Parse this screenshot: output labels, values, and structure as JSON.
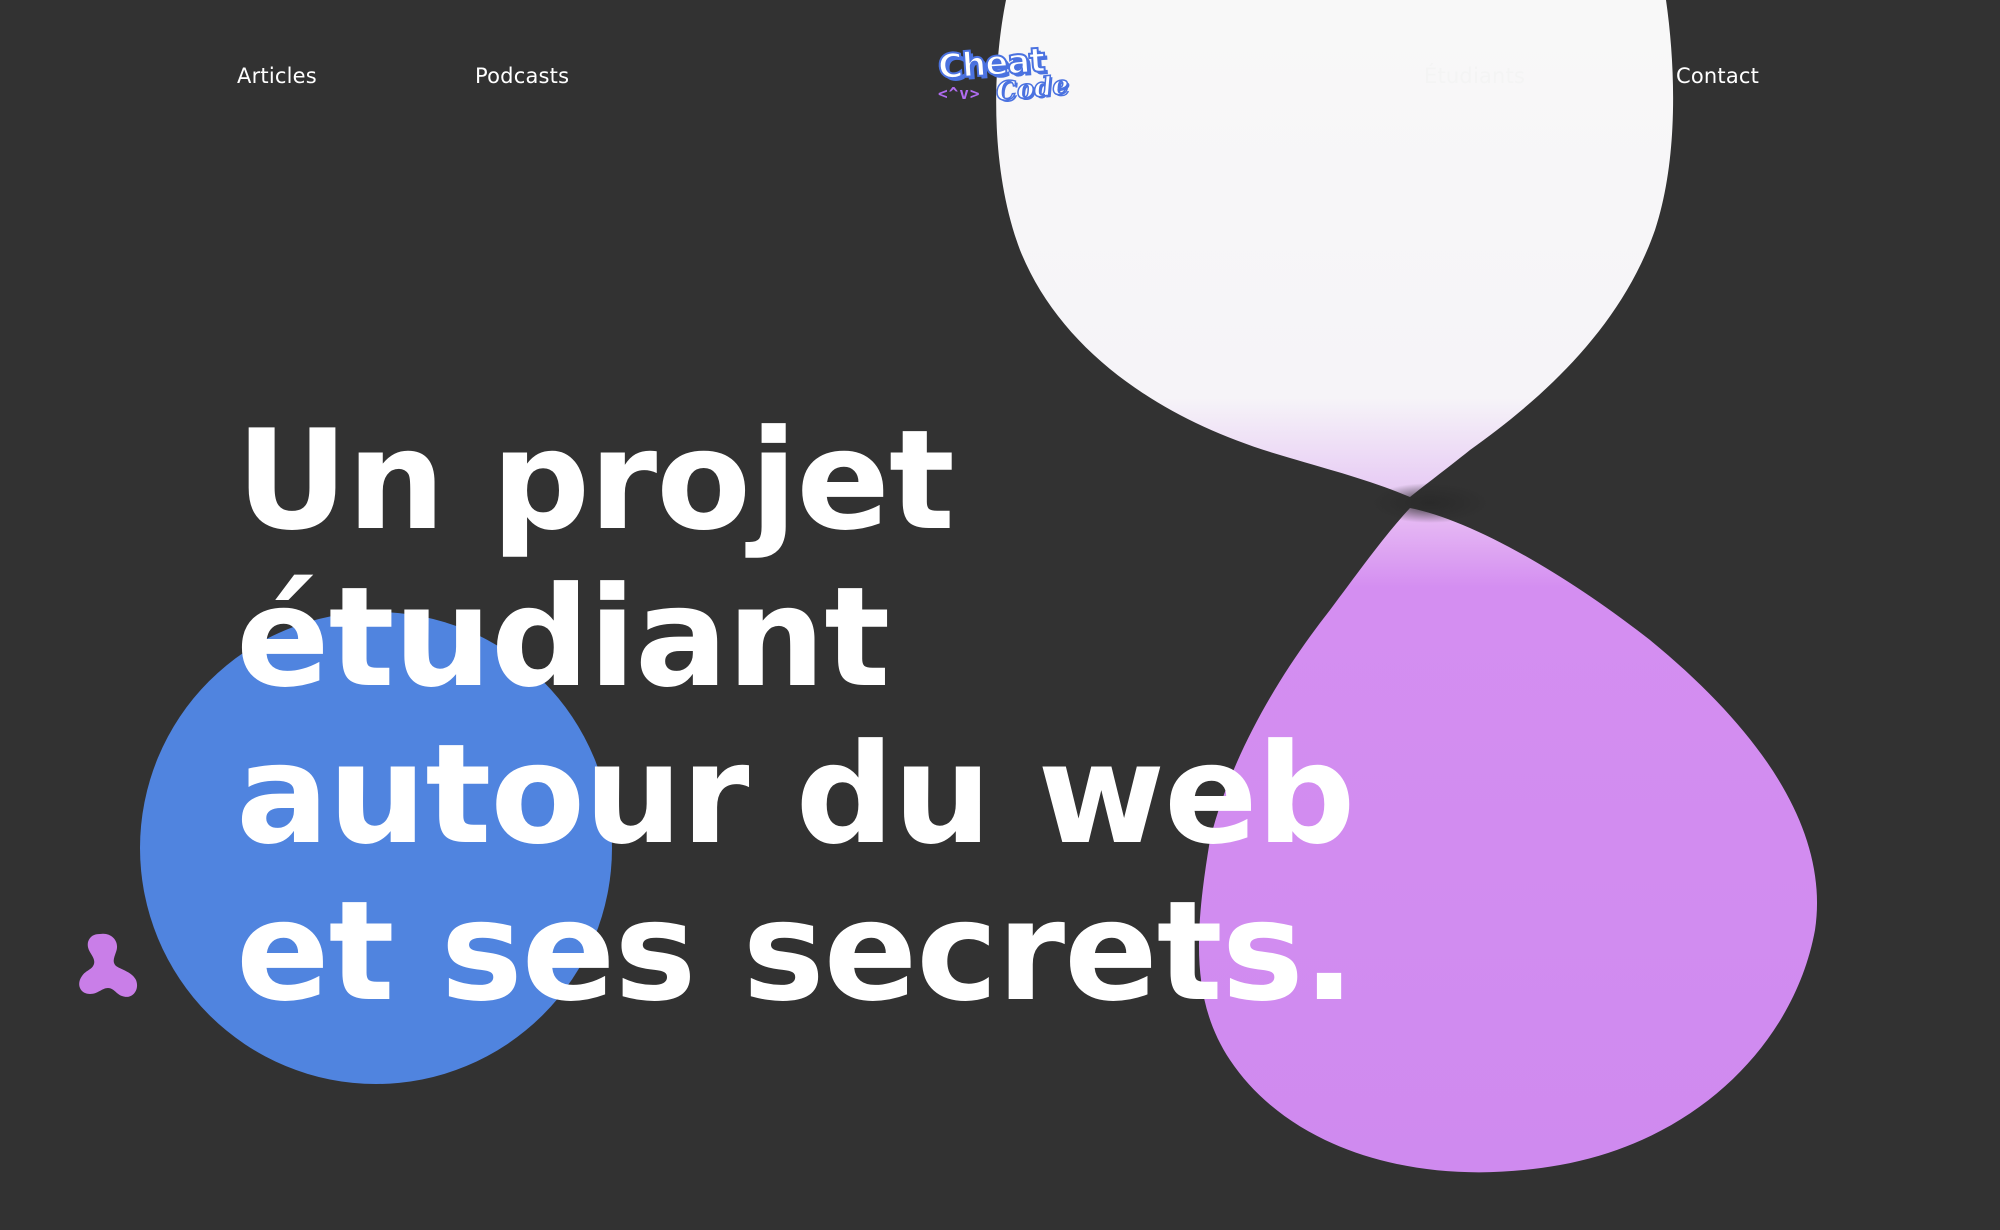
{
  "nav": {
    "left_links": [
      "Articles",
      "Podcasts"
    ],
    "right_links": [
      "Étudiants",
      "Contact"
    ]
  },
  "logo": {
    "line_1": "Cheat",
    "line_2": "Code",
    "brackets": "<^v>"
  },
  "hero": {
    "lines": [
      "Un projet",
      "étudiant",
      "autour du web",
      "et ses secrets."
    ]
  },
  "colors": {
    "background": "#323232",
    "text": "#ffffff",
    "blue_blob": "#5084df",
    "purple_blob": "#d18bf0",
    "white_blob": "#f7f7f7",
    "logo_blue": "#4b72e0",
    "logo_purple": "#b06cf0"
  },
  "icons": {
    "logo": "cheat-code-logo",
    "small_shape": "blob-glyph"
  }
}
